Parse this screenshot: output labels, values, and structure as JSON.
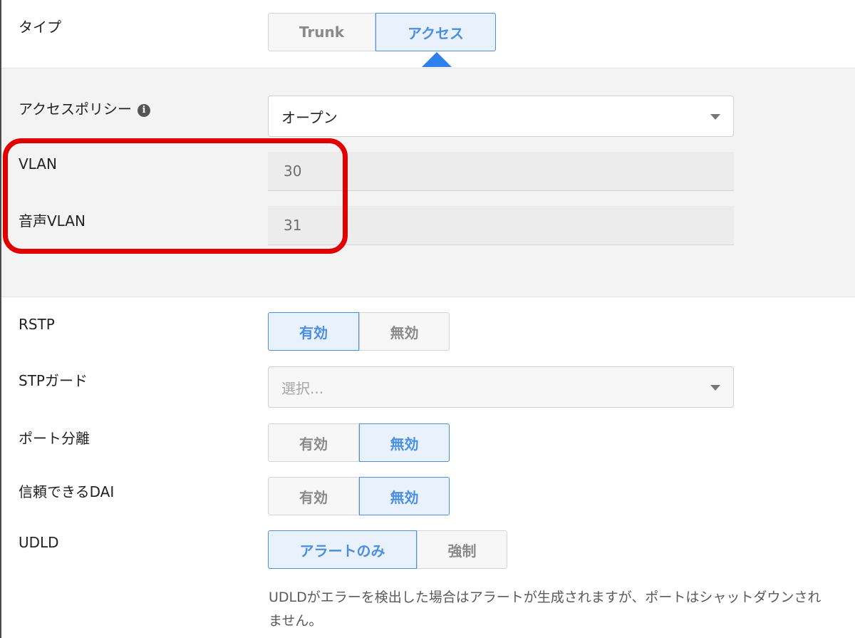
{
  "type": {
    "label": "タイプ",
    "options": [
      "Trunk",
      "アクセス"
    ],
    "selected": "アクセス"
  },
  "access_policy": {
    "label": "アクセスポリシー",
    "info_icon": "info-circle-icon",
    "value": "オープン",
    "dropdown_icon": "caret-down-icon"
  },
  "vlan": {
    "label": "VLAN",
    "value": "30"
  },
  "voice_vlan": {
    "label": "音声VLAN",
    "value": "31"
  },
  "rstp": {
    "label": "RSTP",
    "options": [
      "有効",
      "無効"
    ],
    "selected": "有効"
  },
  "stp_guard": {
    "label": "STPガード",
    "placeholder": "選択..."
  },
  "port_isolation": {
    "label": "ポート分離",
    "options": [
      "有効",
      "無効"
    ],
    "selected": "無効"
  },
  "trusted_dai": {
    "label": "信頼できるDAI",
    "options": [
      "有効",
      "無効"
    ],
    "selected": "無効"
  },
  "udld": {
    "label": "UDLD",
    "options": [
      "アラートのみ",
      "強制"
    ],
    "selected": "アラートのみ",
    "help": "UDLDがエラーを検出した場合はアラートが生成されますが、ポートはシャットダウンされません。"
  },
  "colors": {
    "accent": "#4a8fe0",
    "active_bg": "#e9f1fc",
    "highlight": "#e00000",
    "panel_bg": "#f3f3f3"
  }
}
